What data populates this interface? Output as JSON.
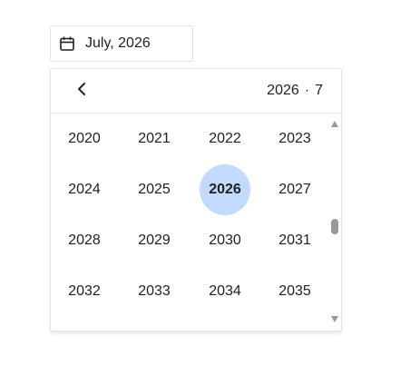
{
  "date_input": {
    "value": "July, 2026",
    "icon": "calendar-icon"
  },
  "picker": {
    "header": {
      "back_icon": "chevron-left-icon",
      "year": "2026",
      "separator": "·",
      "month": "7"
    },
    "years": [
      {
        "label": "2020",
        "selected": false
      },
      {
        "label": "2021",
        "selected": false
      },
      {
        "label": "2022",
        "selected": false
      },
      {
        "label": "2023",
        "selected": false
      },
      {
        "label": "2024",
        "selected": false
      },
      {
        "label": "2025",
        "selected": false
      },
      {
        "label": "2026",
        "selected": true
      },
      {
        "label": "2027",
        "selected": false
      },
      {
        "label": "2028",
        "selected": false
      },
      {
        "label": "2029",
        "selected": false
      },
      {
        "label": "2030",
        "selected": false
      },
      {
        "label": "2031",
        "selected": false
      },
      {
        "label": "2032",
        "selected": false
      },
      {
        "label": "2033",
        "selected": false
      },
      {
        "label": "2034",
        "selected": false
      },
      {
        "label": "2035",
        "selected": false
      }
    ],
    "colors": {
      "selected_bg": "#c2dbfd",
      "border": "#e4e4e4"
    }
  }
}
